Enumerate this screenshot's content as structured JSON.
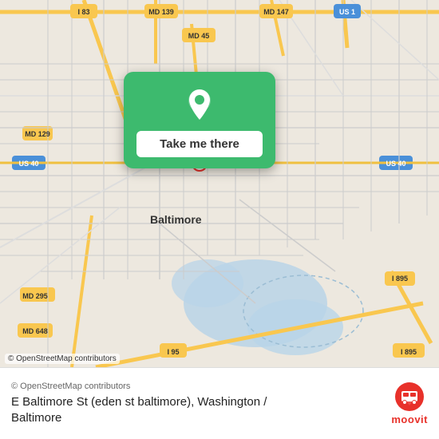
{
  "map": {
    "attribution": "© OpenStreetMap contributors",
    "center_city": "Baltimore"
  },
  "popup": {
    "button_label": "Take me there",
    "pin_color": "#ffffff"
  },
  "footer": {
    "osm_credit": "© OpenStreetMap contributors",
    "location_name": "E Baltimore St (eden st baltimore), Washington /\nBaltimore",
    "brand_name": "moovit"
  }
}
